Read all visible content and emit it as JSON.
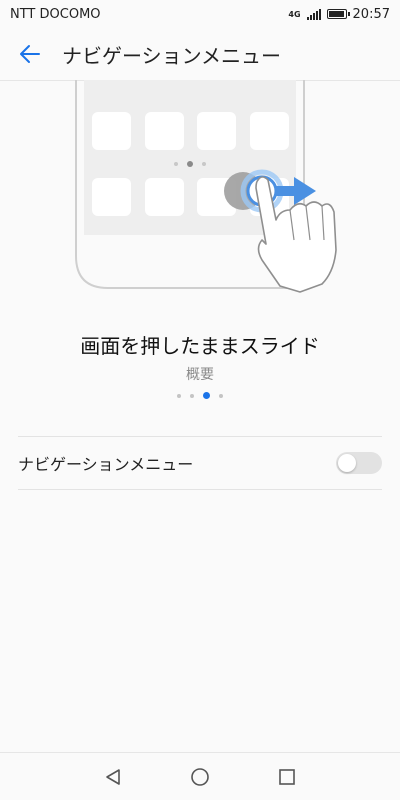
{
  "status": {
    "carrier": "NTT DOCOMO",
    "network": "4G",
    "time": "20:57"
  },
  "header": {
    "title": "ナビゲーションメニュー",
    "back_icon": "arrow-left-icon"
  },
  "tutorial": {
    "title": "画面を押したままスライド",
    "subtitle": "概要",
    "page_count": 4,
    "active_page": 3
  },
  "setting": {
    "label": "ナビゲーションメニュー",
    "enabled": false
  },
  "nav": {
    "buttons": [
      "back-triangle-icon",
      "home-circle-icon",
      "recents-square-icon"
    ]
  },
  "colors": {
    "accent": "#1a73e8",
    "toggle_off": "#e2e2e2",
    "arrow": "#4a90e2"
  }
}
